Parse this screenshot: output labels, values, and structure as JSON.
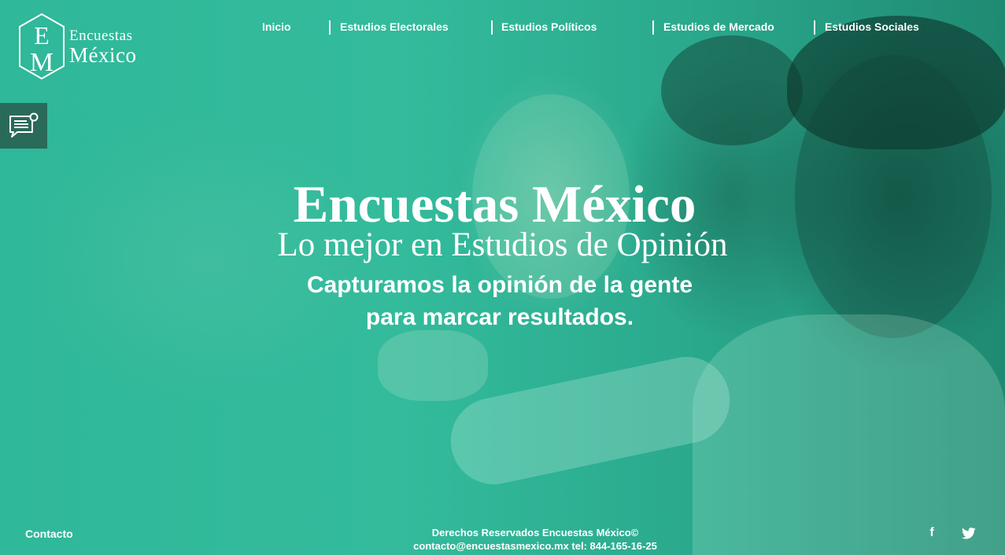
{
  "brand": {
    "monogram_top": "E",
    "monogram_bottom": "M",
    "name_line1": "Encuestas",
    "name_line2": "México"
  },
  "nav": {
    "items": [
      {
        "label": "Inicio"
      },
      {
        "label": "Estudios Electorales"
      },
      {
        "label": "Estudios Políticos"
      },
      {
        "label": "Estudios de Mercado"
      },
      {
        "label": "Estudios Sociales"
      }
    ]
  },
  "side": {
    "chat_icon": "chat-message-icon"
  },
  "hero": {
    "title": "Encuestas México",
    "subtitle": "Lo mejor en Estudios de Opinión",
    "tagline_line1": "Capturamos la opinión de la gente",
    "tagline_line2": "para marcar resultados."
  },
  "footer": {
    "contact_label": "Contacto",
    "rights": "Derechos Reservados Encuestas México©",
    "contact_info": "contacto@encuestasmexico.mx tel: 844-165-16-25",
    "social": [
      {
        "icon": "facebook-icon",
        "glyph": "f"
      },
      {
        "icon": "twitter-icon"
      }
    ]
  },
  "colors": {
    "primary_teal": "#2bb394",
    "side_button": "#2a6a5a",
    "text": "#ffffff"
  }
}
